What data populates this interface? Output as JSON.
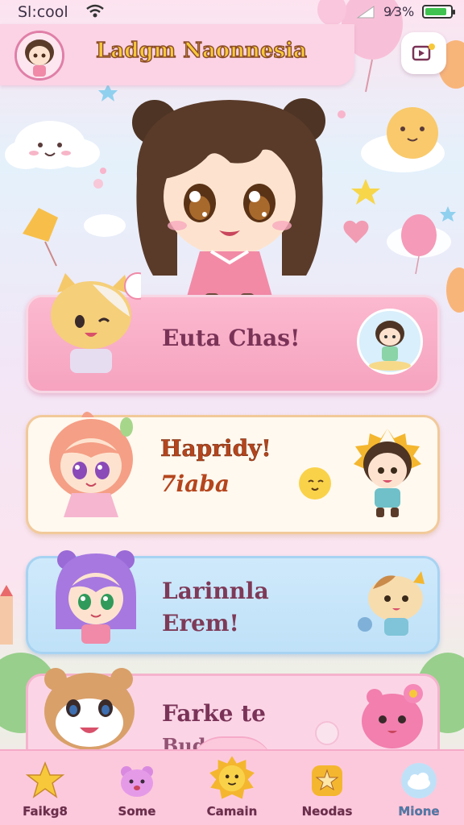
{
  "status_bar": {
    "carrier": "Sl:cool",
    "battery_pct": "9⁄3%"
  },
  "header": {
    "title": "Ladgm Naonnesia"
  },
  "cards": [
    {
      "lines": [
        "Euta Chas!"
      ]
    },
    {
      "lines": [
        "Hapridy!",
        "7iaba"
      ]
    },
    {
      "lines": [
        "Larinnla",
        "Erem!"
      ]
    },
    {
      "lines": [
        "Farke te",
        "Bud-..."
      ]
    }
  ],
  "nav": [
    {
      "label": "Faikg8",
      "icon": "star-icon"
    },
    {
      "label": "Some",
      "icon": "bear-icon"
    },
    {
      "label": "Camain",
      "icon": "sun-cat-icon"
    },
    {
      "label": "Neodas",
      "icon": "badge-star-icon"
    },
    {
      "label": "Mione",
      "icon": "cloud-icon"
    }
  ],
  "colors": {
    "accent_pink": "#fbd3e4",
    "title_yellow": "#f7c93a",
    "nav_bg": "#fcc9dc",
    "active_blue": "#4a7fb0"
  }
}
